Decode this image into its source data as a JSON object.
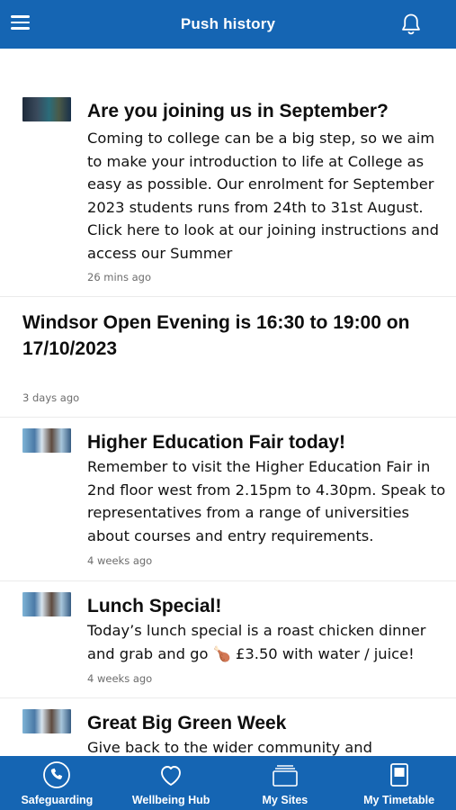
{
  "header": {
    "title": "Push history"
  },
  "items": [
    {
      "title": "Are you joining us in September?",
      "body": "Coming to college can be a big step, so we aim to make your introduction to life at College as easy as possible. Our enrolment for September 2023 students runs from 24th to 31st August. Click here to look at our joining instructions and access our Summer",
      "time": "26 mins ago"
    },
    {
      "title": "Windsor Open Evening is 16:30 to 19:00 on 17/10/2023",
      "time": "3 days ago"
    },
    {
      "title": "Higher Education Fair today!",
      "body": "Remember to visit the Higher Education Fair in 2nd floor west from 2.15pm to 4.30pm. Speak to representatives from a range of universities about courses and entry requirements.",
      "time": "4 weeks ago"
    },
    {
      "title": "Lunch Special!",
      "body": "Today’s lunch special is a roast chicken dinner and grab and go 🍗 £3.50 with water / juice!",
      "time": "4 weeks ago"
    },
    {
      "title": "Great Big Green Week",
      "body": "Give back to the wider community and"
    }
  ],
  "tabs": [
    {
      "label": "Safeguarding",
      "icon": "phone-icon"
    },
    {
      "label": "Wellbeing Hub",
      "icon": "heart-icon"
    },
    {
      "label": "My Sites",
      "icon": "stack-icon"
    },
    {
      "label": "My Timetable",
      "icon": "timetable-icon"
    }
  ],
  "colors": {
    "brand": "#1565b3"
  }
}
